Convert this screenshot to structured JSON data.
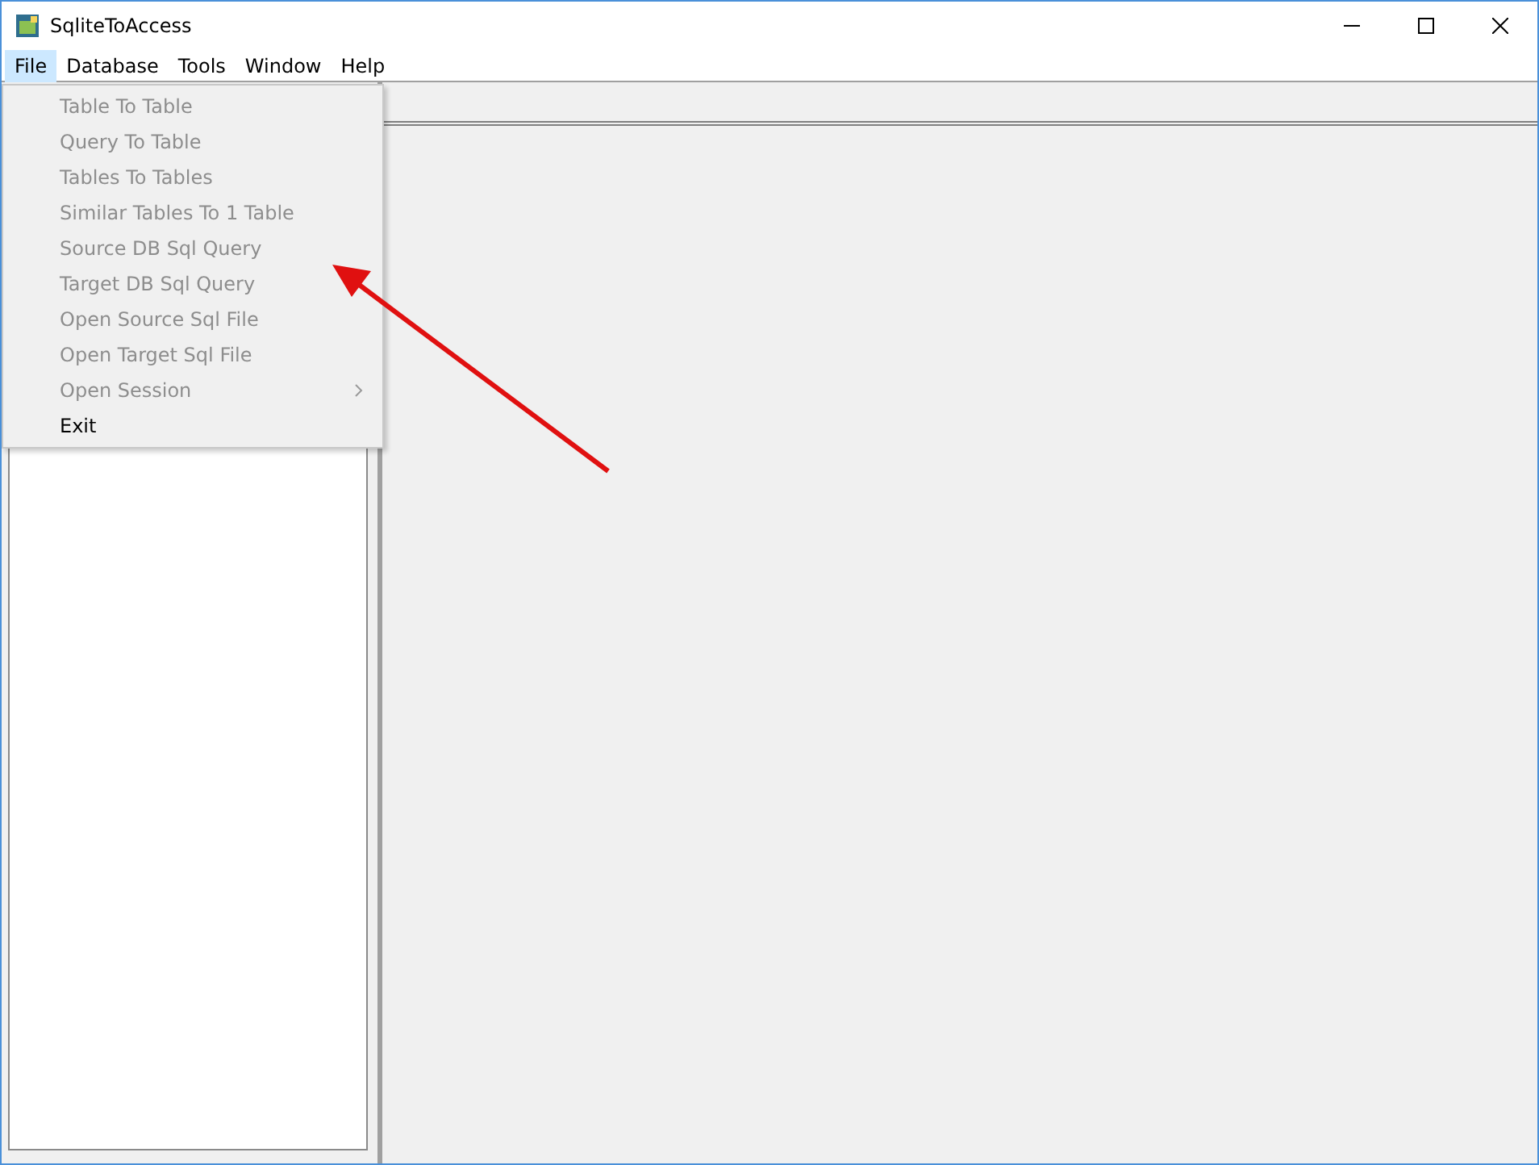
{
  "window": {
    "title": "SqliteToAccess"
  },
  "menu_bar": [
    {
      "label": "File",
      "selected": true
    },
    {
      "label": "Database",
      "selected": false
    },
    {
      "label": "Tools",
      "selected": false
    },
    {
      "label": "Window",
      "selected": false
    },
    {
      "label": "Help",
      "selected": false
    }
  ],
  "file_menu": [
    {
      "label": "Table To Table",
      "disabled": true,
      "submenu": false
    },
    {
      "label": "Query To Table",
      "disabled": true,
      "submenu": false
    },
    {
      "label": "Tables To Tables",
      "disabled": true,
      "submenu": false
    },
    {
      "label": "Similar Tables To 1 Table",
      "disabled": true,
      "submenu": false
    },
    {
      "label": "Source DB Sql Query",
      "disabled": true,
      "submenu": false
    },
    {
      "label": "Target DB Sql Query",
      "disabled": true,
      "submenu": false
    },
    {
      "label": "Open Source Sql File",
      "disabled": true,
      "submenu": false
    },
    {
      "label": "Open Target Sql File",
      "disabled": true,
      "submenu": false
    },
    {
      "label": "Open Session",
      "disabled": true,
      "submenu": true
    },
    {
      "label": "Exit",
      "disabled": false,
      "submenu": false
    }
  ]
}
